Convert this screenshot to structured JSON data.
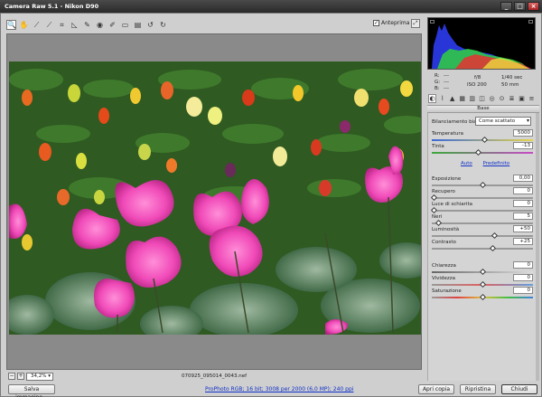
{
  "window": {
    "title": "Camera Raw 5.1  -  Nikon D90"
  },
  "toolbar": {
    "preview_label": "Anteprima",
    "preview_checked": true
  },
  "status": {
    "zoom": "34,2%",
    "filename": "070925_095014_0043.nef"
  },
  "footer": {
    "save_label": "Salva immagine...",
    "workflow_link": "ProPhoto RGB; 16 bit; 3008 per 2000 (6,0 MP); 240 ppi",
    "open_label": "Apri copia",
    "reset_label": "Ripristina",
    "close_label": "Chiudi"
  },
  "readout": {
    "r": "R:",
    "g": "G:",
    "b": "B:",
    "r_val": "---",
    "g_val": "---",
    "b_val": "---",
    "aperture": "f/8",
    "shutter": "1/40 sec",
    "iso": "ISO 200",
    "focal": "50 mm"
  },
  "panel": {
    "title": "Base",
    "wb_label": "Bilanciamento bianco:",
    "wb_value": "Come scattato",
    "auto_link": "Auto",
    "default_link": "Predefinito",
    "sliders": [
      {
        "label": "Temperatura",
        "value": "5000",
        "level": 0.52
      },
      {
        "label": "Tinta",
        "value": "-13",
        "level": 0.45
      },
      {
        "label": "Esposizione",
        "value": "0,00",
        "level": 0.5
      },
      {
        "label": "Recupero",
        "value": "0",
        "level": 0.0
      },
      {
        "label": "Luce di schiarita",
        "value": "0",
        "level": 0.0
      },
      {
        "label": "Neri",
        "value": "5",
        "level": 0.05
      },
      {
        "label": "Luminosità",
        "value": "+50",
        "level": 0.62
      },
      {
        "label": "Contrasto",
        "value": "+25",
        "level": 0.6
      },
      {
        "label": "Chiarezza",
        "value": "0",
        "level": 0.5
      },
      {
        "label": "Vividezza",
        "value": "0",
        "level": 0.5
      },
      {
        "label": "Saturazione",
        "value": "0",
        "level": 0.5
      }
    ]
  }
}
